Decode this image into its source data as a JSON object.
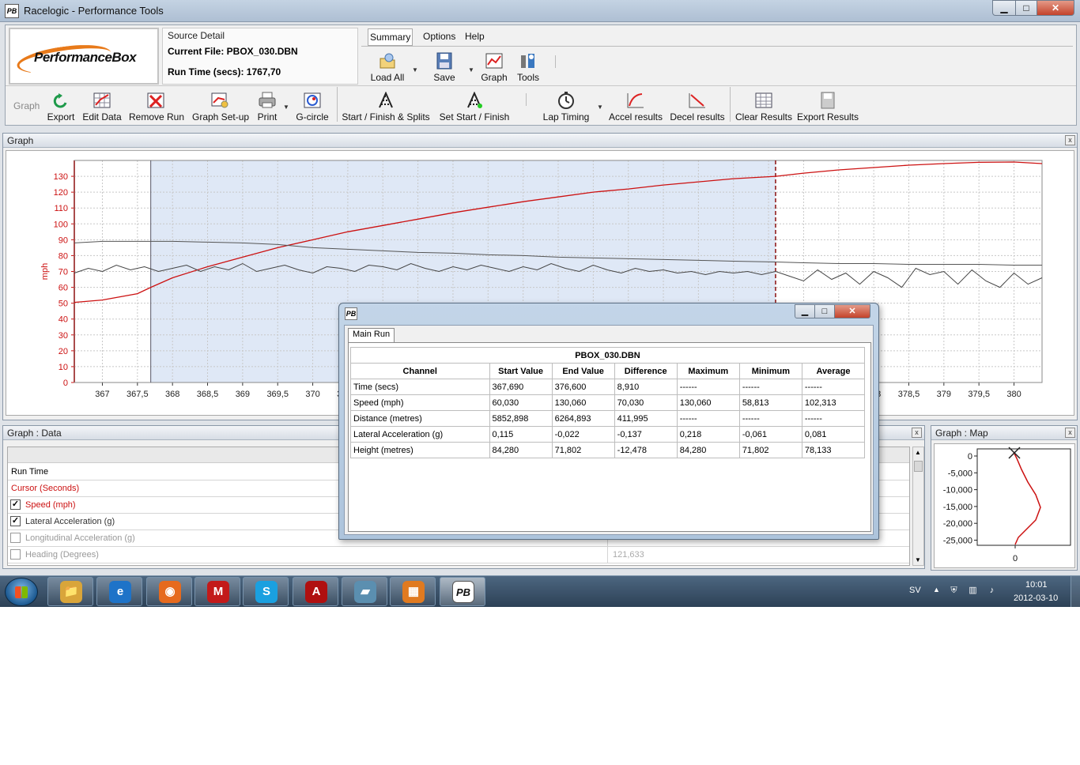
{
  "window": {
    "title": "Racelogic - Performance Tools",
    "icon_text": "PB",
    "min": "▁",
    "max": "□",
    "close": "✕"
  },
  "logo": {
    "text": "PerformanceBox"
  },
  "source": {
    "title": "Source Detail",
    "current_file": "Current File: PBOX_030.DBN",
    "run_time": "Run Time (secs): 1767,70"
  },
  "menu": {
    "summary": "Summary",
    "options": "Options",
    "help": "Help"
  },
  "top_tools": [
    {
      "label": "Load All",
      "icon": "load-icon"
    },
    {
      "label": "Save",
      "icon": "save-icon"
    },
    {
      "label": "Graph",
      "icon": "graph-icon"
    },
    {
      "label": "Tools",
      "icon": "tools-icon"
    }
  ],
  "graph_toolbar": {
    "group_label": "Graph",
    "buttons": [
      {
        "label": "Export",
        "icon": "export-icon"
      },
      {
        "label": "Edit Data",
        "icon": "edit-data-icon"
      },
      {
        "label": "Remove Run",
        "icon": "remove-run-icon"
      },
      {
        "label": "Graph Set-up",
        "icon": "graph-setup-icon"
      },
      {
        "label": "Print",
        "icon": "print-icon"
      },
      {
        "label": "G-circle",
        "icon": "g-circle-icon"
      },
      {
        "label": "Start / Finish & Splits",
        "icon": "checkered-flag-icon"
      },
      {
        "label": "Set Start / Finish",
        "icon": "set-flag-icon"
      },
      {
        "label": "Lap Timing",
        "icon": "stopwatch-icon"
      },
      {
        "label": "Accel results",
        "icon": "accel-icon"
      },
      {
        "label": "Decel results",
        "icon": "decel-icon"
      },
      {
        "label": "Clear Results",
        "icon": "clear-results-icon"
      },
      {
        "label": "Export Results",
        "icon": "export-results-icon"
      }
    ]
  },
  "graph_panel": {
    "title": "Graph",
    "close": "x"
  },
  "chart_data": {
    "type": "line",
    "ylabel": "mph",
    "ylim": [
      0,
      140
    ],
    "yticks": [
      0,
      10,
      20,
      30,
      40,
      50,
      60,
      70,
      80,
      90,
      100,
      110,
      120,
      130
    ],
    "xlim": [
      366.6,
      380.4
    ],
    "xticks": [
      "367",
      "367,5",
      "368",
      "368,5",
      "369",
      "369,5",
      "370",
      "370,5",
      "371",
      "371,5",
      "372",
      "372,5",
      "373",
      "373,5",
      "374",
      "374,5",
      "375",
      "375,5",
      "376",
      "376,5",
      "377",
      "377,5",
      "378",
      "378,5",
      "379",
      "379,5",
      "380"
    ],
    "grid": true,
    "selection": {
      "start": 367.69,
      "end": 376.6
    },
    "series": [
      {
        "color": "#cc1111",
        "axis": "speed",
        "x": [
          366.6,
          367.0,
          367.5,
          367.69,
          368.0,
          368.5,
          369.0,
          369.5,
          370.0,
          370.5,
          371.0,
          371.5,
          372.0,
          372.5,
          373.0,
          373.5,
          374.0,
          374.5,
          375.0,
          375.5,
          376.0,
          376.6,
          377.0,
          377.5,
          378.0,
          378.5,
          379.0,
          379.5,
          380.0,
          380.4
        ],
        "y": [
          50.5,
          52,
          56,
          60,
          66,
          73,
          79,
          85,
          90,
          95,
          99,
          103,
          107,
          110.5,
          114,
          117,
          120,
          122,
          124.5,
          126.5,
          128.5,
          130,
          132,
          134,
          135.5,
          137,
          138,
          138.8,
          139,
          138
        ]
      },
      {
        "color": "#555555",
        "axis": "lateral",
        "x": [
          366.6,
          367.0,
          367.5,
          368.0,
          368.5,
          369.0,
          369.5,
          370.0,
          370.5,
          371.0,
          371.5,
          372.0,
          372.5,
          373.0,
          373.5,
          374.0,
          374.5,
          375.0,
          375.5,
          376.0,
          376.6,
          377.0,
          377.5,
          378.0,
          378.5,
          379.0,
          379.5,
          380.0,
          380.4
        ],
        "y": [
          88,
          89,
          89,
          89,
          88.5,
          88,
          87,
          85,
          84,
          83,
          82,
          81.5,
          80.5,
          80,
          79,
          78.5,
          78,
          77.5,
          77,
          76.5,
          76,
          75.5,
          75,
          75,
          74.5,
          74.5,
          74.5,
          74,
          74
        ]
      },
      {
        "color": "#444444",
        "axis": "height",
        "x": [
          366.6,
          366.8,
          367.0,
          367.2,
          367.4,
          367.6,
          367.8,
          368.0,
          368.2,
          368.4,
          368.6,
          368.8,
          369.0,
          369.2,
          369.4,
          369.6,
          369.8,
          370.0,
          370.2,
          370.4,
          370.6,
          370.8,
          371.0,
          371.2,
          371.4,
          371.6,
          371.8,
          372.0,
          372.2,
          372.4,
          372.6,
          372.8,
          373.0,
          373.2,
          373.4,
          373.6,
          373.8,
          374.0,
          374.2,
          374.4,
          374.6,
          374.8,
          375.0,
          375.2,
          375.4,
          375.6,
          375.8,
          376.0,
          376.2,
          376.4,
          376.6,
          376.8,
          377.0,
          377.2,
          377.4,
          377.6,
          377.8,
          378.0,
          378.2,
          378.4,
          378.6,
          378.8,
          379.0,
          379.2,
          379.4,
          379.6,
          379.8,
          380.0,
          380.2,
          380.4
        ],
        "y": [
          69,
          72,
          70,
          74,
          71,
          73,
          70,
          72,
          74,
          70,
          73,
          71,
          75,
          70,
          72,
          74,
          71,
          69,
          73,
          72,
          70,
          74,
          73,
          71,
          75,
          72,
          70,
          73,
          71,
          74,
          72,
          70,
          73,
          71,
          75,
          72,
          70,
          74,
          71,
          69,
          72,
          70,
          71,
          69,
          70,
          68,
          70,
          69,
          70,
          68,
          70,
          67,
          64,
          71,
          65,
          69,
          62,
          70,
          66,
          60,
          72,
          68,
          70,
          62,
          71,
          64,
          60,
          69,
          62,
          66
        ]
      }
    ]
  },
  "dialog": {
    "icon_text": "PB",
    "min": "▁",
    "max": "□",
    "close": "✕",
    "tab": "Main Run",
    "file": "PBOX_030.DBN",
    "columns": [
      "Channel",
      "Start Value",
      "End Value",
      "Difference",
      "Maximum",
      "Minimum",
      "Average"
    ],
    "rows": [
      [
        "Time (secs)",
        "367,690",
        "376,600",
        "8,910",
        "------",
        "------",
        "------"
      ],
      [
        "Speed (mph)",
        "60,030",
        "130,060",
        "70,030",
        "130,060",
        "58,813",
        "102,313"
      ],
      [
        "Distance (metres)",
        "5852,898",
        "6264,893",
        "411,995",
        "------",
        "------",
        "------"
      ],
      [
        "Lateral Acceleration (g)",
        "0,115",
        "-0,022",
        "-0,137",
        "0,218",
        "-0,061",
        "0,081"
      ],
      [
        "Height (metres)",
        "84,280",
        "71,802",
        "-12,478",
        "84,280",
        "71,802",
        "78,133"
      ]
    ]
  },
  "data_panel": {
    "title": "Graph : Data",
    "close": "x",
    "rows": [
      {
        "label": "Run Time",
        "checkbox": null,
        "color": "#000000",
        "value": ""
      },
      {
        "label": "Cursor (Seconds)",
        "checkbox": null,
        "color": "#cc1111",
        "value": ""
      },
      {
        "label": "Speed (mph)",
        "checkbox": true,
        "color": "#cc1111",
        "value": ""
      },
      {
        "label": "Lateral Acceleration (g)",
        "checkbox": true,
        "color": "#333333",
        "value": ""
      },
      {
        "label": "Longitudinal Acceleration (g)",
        "checkbox": false,
        "color": "#999999",
        "value": ""
      },
      {
        "label": "Heading (Degrees)",
        "checkbox": false,
        "color": "#999999",
        "value": "121,633"
      }
    ]
  },
  "map_panel": {
    "title": "Graph : Map",
    "close": "x",
    "yticks": [
      "0",
      "-5,000",
      "-10,000",
      "-15,000",
      "-20,000",
      "-25,000"
    ],
    "xtick": "0"
  },
  "taskbar": {
    "apps": [
      {
        "name": "explorer",
        "glyph": "📁",
        "color": "#d9a53a"
      },
      {
        "name": "internet-explorer",
        "glyph": "e",
        "color": "#1e73c8"
      },
      {
        "name": "firefox",
        "glyph": "◉",
        "color": "#e66a1e"
      },
      {
        "name": "mcafee",
        "glyph": "M",
        "color": "#c31a1a"
      },
      {
        "name": "skype",
        "glyph": "S",
        "color": "#1aa0e0"
      },
      {
        "name": "acrobat",
        "glyph": "A",
        "color": "#b01010"
      },
      {
        "name": "app-blue",
        "glyph": "▰",
        "color": "#5b8fb0"
      },
      {
        "name": "app-orange",
        "glyph": "▦",
        "color": "#e07a20"
      },
      {
        "name": "performancebox",
        "glyph": "PB",
        "color": "#ffffff"
      }
    ],
    "lang": "SV",
    "tray_up": "▲",
    "time": "10:01",
    "date": "2012-03-10"
  }
}
